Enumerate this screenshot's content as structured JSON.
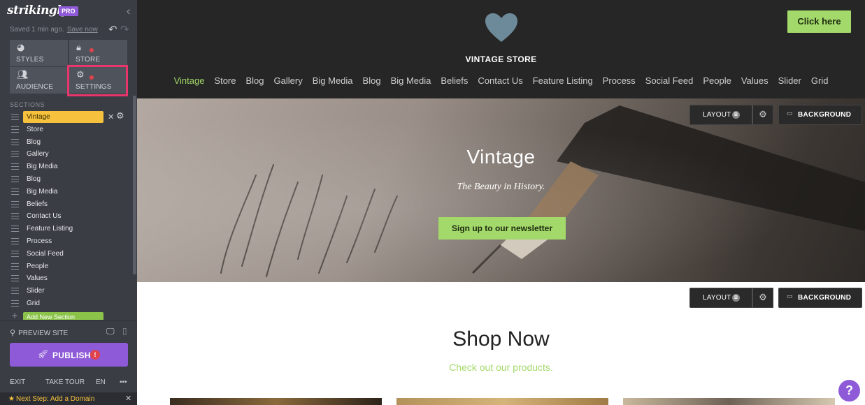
{
  "sidebar": {
    "logo": "strikingly",
    "pro_badge": "PRO",
    "saved_text": "Saved 1 min ago.",
    "save_now": "Save now",
    "tiles": {
      "styles": "STYLES",
      "store": "STORE",
      "audience": "AUDIENCE",
      "settings": "SETTINGS"
    },
    "sections_header": "SECTIONS",
    "sections": [
      {
        "label": "Vintage"
      },
      {
        "label": "Store"
      },
      {
        "label": "Blog"
      },
      {
        "label": "Gallery"
      },
      {
        "label": "Big Media"
      },
      {
        "label": "Blog"
      },
      {
        "label": "Big Media"
      },
      {
        "label": "Beliefs"
      },
      {
        "label": "Contact Us"
      },
      {
        "label": "Feature Listing"
      },
      {
        "label": "Process"
      },
      {
        "label": "Social Feed"
      },
      {
        "label": "People"
      },
      {
        "label": "Values"
      },
      {
        "label": "Slider"
      },
      {
        "label": "Grid"
      }
    ],
    "add_section": "Add New Section",
    "preview_site": "PREVIEW SITE",
    "publish": "PUBLISH",
    "publish_alert": "!",
    "exit": "EXIT",
    "take_tour": "TAKE TOUR",
    "language": "EN",
    "more": "•••",
    "next_step": "Next Step: Add a Domain"
  },
  "site": {
    "store_name": "VINTAGE STORE",
    "cta": "Click here",
    "nav": [
      "Vintage",
      "Store",
      "Blog",
      "Gallery",
      "Big Media",
      "Blog",
      "Big Media",
      "Beliefs",
      "Contact Us",
      "Feature Listing",
      "Process",
      "Social Feed",
      "People",
      "Values",
      "Slider",
      "Grid"
    ],
    "nav_active": "Vintage"
  },
  "hero": {
    "title": "Vintage",
    "subtitle": "The Beauty in History.",
    "button": "Sign up to our newsletter"
  },
  "controls": {
    "layout": "LAYOUT",
    "layout_badge": "B",
    "background": "BACKGROUND"
  },
  "shop": {
    "title": "Shop Now",
    "subtitle": "Check out our products."
  },
  "help": "?",
  "colors": {
    "accent_green": "#a3d96a",
    "brand_purple": "#8e5ad8",
    "highlight_pink": "#e8366d",
    "active_section_yellow": "#f6c13c",
    "sidebar_bg": "#3a3d44",
    "header_bg": "#262626"
  },
  "icons": [
    "chevron-left-icon",
    "undo-icon",
    "redo-icon",
    "palette-icon",
    "bag-icon",
    "people-icon",
    "gear-icon",
    "drag-handle-icon",
    "close-icon",
    "plus-icon",
    "search-icon",
    "desktop-icon",
    "mobile-icon",
    "rocket-icon",
    "arrow-left-icon",
    "star-icon",
    "heart-icon",
    "image-icon",
    "help-icon"
  ]
}
